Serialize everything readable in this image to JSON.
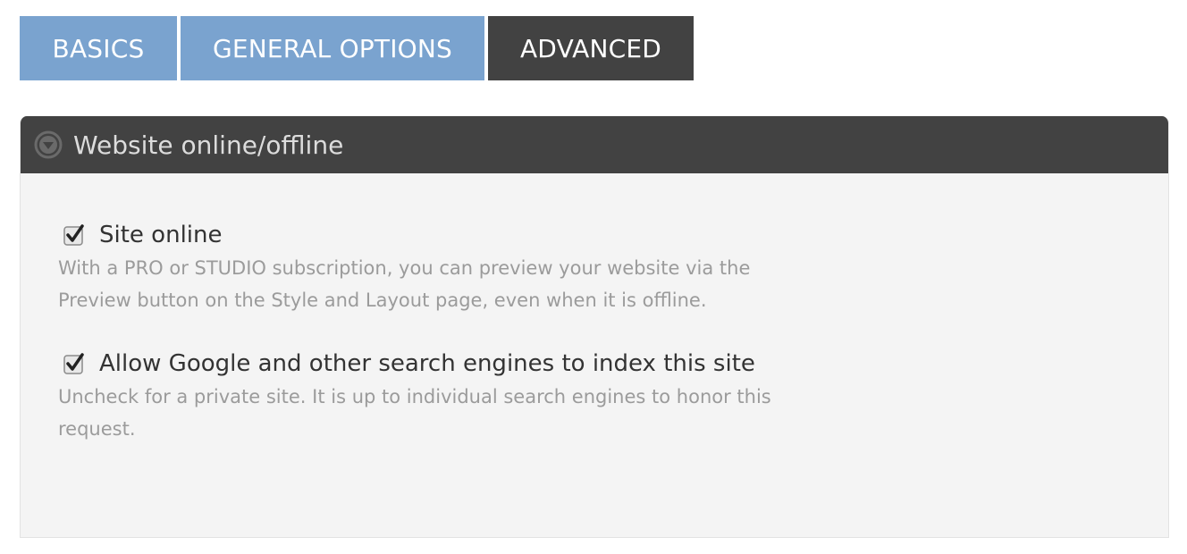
{
  "tabs": [
    {
      "label": "BASICS",
      "active": false
    },
    {
      "label": "GENERAL OPTIONS",
      "active": false
    },
    {
      "label": "ADVANCED",
      "active": true
    }
  ],
  "section": {
    "title": "Website online/offline",
    "icon": "collapse-circle-down-icon"
  },
  "options": [
    {
      "label": "Site online",
      "checked": true,
      "help": "With a PRO or STUDIO subscription, you can preview your website via the Preview button on the Style and Layout page, even when it is offline."
    },
    {
      "label": "Allow Google and other search engines to index this site",
      "checked": true,
      "help": "Uncheck for a private site. It is up to individual search engines to honor this request."
    }
  ],
  "colors": {
    "tab_inactive": "#7aa3cf",
    "tab_active": "#424242",
    "panel_header": "#424242",
    "panel_body": "#f4f4f4"
  }
}
